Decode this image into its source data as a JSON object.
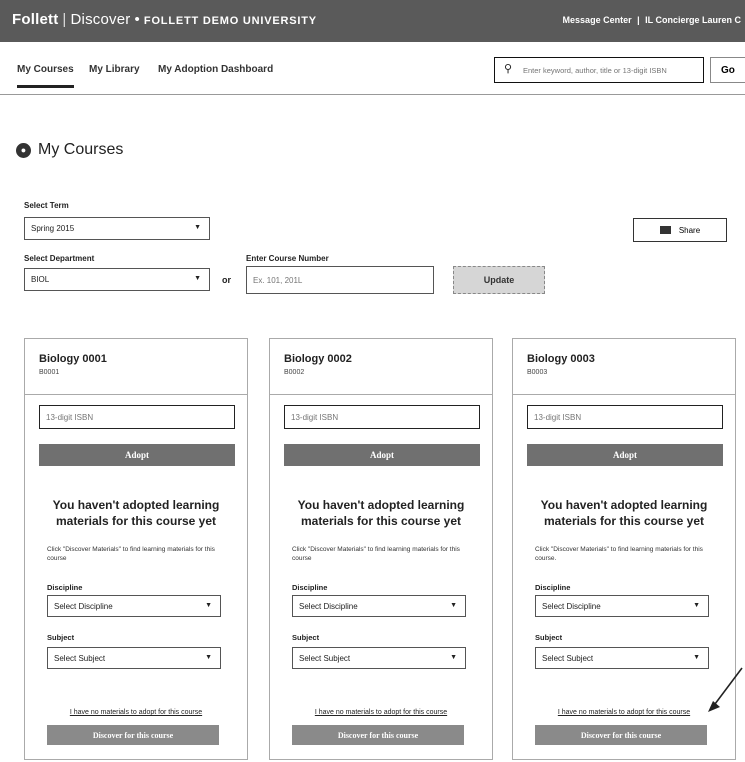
{
  "header": {
    "brand": "Follett",
    "product": "Discover",
    "separator": "•",
    "institution": "FOLLETT DEMO UNIVERSITY",
    "message_center": "Message Center",
    "user": "IL Concierge Lauren C"
  },
  "nav": {
    "tabs": [
      {
        "label": "My Courses",
        "active": true
      },
      {
        "label": "My Library",
        "active": false
      },
      {
        "label": "My Adoption Dashboard",
        "active": false
      }
    ],
    "search_placeholder": "Enter keyword, author, title or 13-digit ISBN",
    "go_label": "Go"
  },
  "page": {
    "title": "My Courses",
    "select_term_label": "Select Term",
    "term_value": "Spring 2015",
    "select_department_label": "Select Department",
    "department_value": "BIOL",
    "or_label": "or",
    "course_number_label": "Enter Course Number",
    "course_number_placeholder": "Ex. 101, 201L",
    "update_label": "Update",
    "share_label": "Share"
  },
  "courses": [
    {
      "title": "Biology 0001",
      "code": "B0001",
      "isbn_placeholder": "13-digit ISBN",
      "adopt_label": "Adopt",
      "message": "You haven't adopted learning materials for this course yet",
      "hint": "Click \"Discover Materials\" to find learning materials for this course",
      "discipline_label": "Discipline",
      "discipline_value": "Select Discipline",
      "subject_label": "Subject",
      "subject_value": "Select Subject",
      "no_materials_link": "I have no materials to adopt for this course",
      "discover_label": "Discover for this course"
    },
    {
      "title": "Biology 0002",
      "code": "B0002",
      "isbn_placeholder": "13-digit ISBN",
      "adopt_label": "Adopt",
      "message": "You haven't adopted learning materials for this course yet",
      "hint": "Click \"Discover Materials\" to find learning materials for this course",
      "discipline_label": "Discipline",
      "discipline_value": "Select Discipline",
      "subject_label": "Subject",
      "subject_value": "Select Subject",
      "no_materials_link": "I have no materials to adopt for this course",
      "discover_label": "Discover for this course"
    },
    {
      "title": "Biology 0003",
      "code": "B0003",
      "isbn_placeholder": "13-digit ISBN",
      "adopt_label": "Adopt",
      "message": "You haven't adopted learning materials for this course yet",
      "hint": "Click \"Discover Materials\" to find learning materials for this course.",
      "discipline_label": "Discipline",
      "discipline_value": "Select Discipline",
      "subject_label": "Subject",
      "subject_value": "Select Subject",
      "no_materials_link": "I have no materials to adopt for this course",
      "discover_label": "Discover for this course"
    }
  ],
  "icons": {
    "search": "search-icon",
    "caret": "chevron-down-icon",
    "share": "share-icon",
    "courses": "courses-icon",
    "annotation": "arrow-icon"
  },
  "colors": {
    "header_bg": "#5a5a5a",
    "button_dark": "#707070",
    "button_mid": "#8a8a8a"
  }
}
